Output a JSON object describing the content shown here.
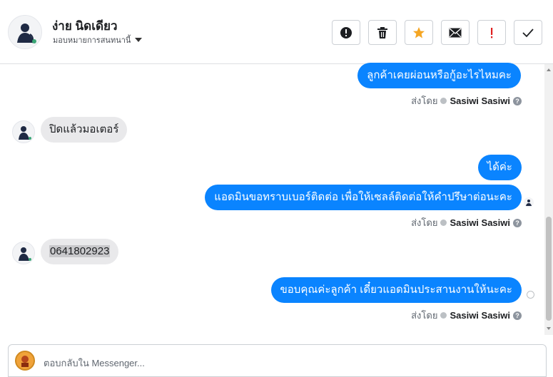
{
  "header": {
    "contact_name": "ง่าย นิดเดียว",
    "assign_label": "มอบหมายการสนทนานี้",
    "actions": [
      {
        "name": "spam-button",
        "icon": "exclamation-circle-icon",
        "color": "#1c1e21"
      },
      {
        "name": "delete-button",
        "icon": "trash-icon",
        "color": "#1c1e21"
      },
      {
        "name": "star-button",
        "icon": "star-icon",
        "color": "#f5a623"
      },
      {
        "name": "mark-unread-button",
        "icon": "envelope-icon",
        "color": "#1c1e21"
      },
      {
        "name": "follow-up-button",
        "icon": "exclamation-icon",
        "color": "#e02020"
      },
      {
        "name": "mark-done-button",
        "icon": "checkmark-icon",
        "color": "#1c1e21"
      }
    ]
  },
  "messages": [
    {
      "id": "m1",
      "direction": "outgoing",
      "text": "ลูกค้าเคยผ่อนหรือกู้อะไรไหมคะ"
    },
    {
      "id": "m2",
      "direction": "incoming",
      "text": "ปิดแล้วมอเตอร์"
    },
    {
      "id": "m3",
      "direction": "outgoing",
      "text": "ได้ค่ะ"
    },
    {
      "id": "m4",
      "direction": "outgoing",
      "text": "แอดมินขอทราบเบอร์ติดต่อ เพื่อให้เซลล์ติดต่อให้คำปรึษาต่อนะคะ"
    },
    {
      "id": "m5",
      "direction": "incoming",
      "text": "0641802923"
    },
    {
      "id": "m6",
      "direction": "outgoing",
      "text": "ขอบคุณค่ะลูกค้า เดี๋ยวแอดมินประสานงานให้นะคะ"
    }
  ],
  "sent_by": {
    "prefix": "ส่งโดย",
    "agent": "Sasiwi Sasiwi"
  },
  "composer": {
    "placeholder": "ตอบกลับใน Messenger..."
  },
  "colors": {
    "outgoing_bubble": "#0a84ff",
    "incoming_bubble": "#e9e9eb"
  }
}
